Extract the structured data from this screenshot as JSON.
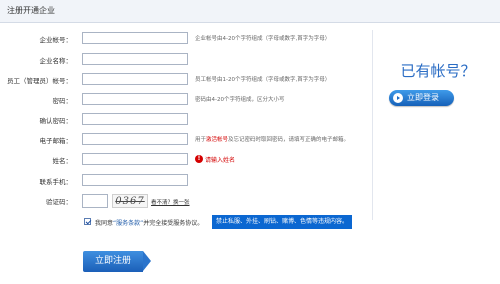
{
  "header": {
    "title": "注册开通企业"
  },
  "form": {
    "enterprise_account": {
      "label": "企业帐号：",
      "hint": "企业帐号由4-20个字符组成（字母或数字,首字为字母）"
    },
    "enterprise_name": {
      "label": "企业名称："
    },
    "admin_account": {
      "label": "员工（管理员）帐号：",
      "hint": "员工帐号由1-20个字符组成（字母或数字,首字为字母）"
    },
    "password": {
      "label": "密码：",
      "hint": "密码由4-20个字符组成，区分大小写"
    },
    "confirm_password": {
      "label": "确认密码："
    },
    "email": {
      "label": "电子邮箱：",
      "hint_prefix": "用于",
      "hint_link": "激活帐号",
      "hint_suffix": "及忘记密码时取回密码，请填写正确的电子邮箱。"
    },
    "name": {
      "label": "姓名：",
      "error_icon": "!",
      "error": "请输入姓名"
    },
    "phone": {
      "label": "联系手机："
    },
    "captcha": {
      "label": "验证码：",
      "image_text": "0367",
      "refresh": "看不清？换一张"
    }
  },
  "agreement": {
    "prefix": "我同意",
    "link": "“服务条款”",
    "suffix": "并完全接受服务协议。",
    "notice": "禁止私服、外挂、刷钻、赌博、色情等违规内容。"
  },
  "register_button": {
    "label": "立即注册"
  },
  "login_panel": {
    "heading": "已有帐号？",
    "button_label": "立即登录"
  },
  "icons": {
    "error": "error-icon",
    "login_arrow": "arrow-right-circle-icon",
    "checkbox": "checkbox-checked-icon"
  },
  "colors": {
    "accent": "#1b5fb8",
    "error": "#d40000",
    "notice_bg": "#0b67d1",
    "heading": "#2a6cc4"
  }
}
